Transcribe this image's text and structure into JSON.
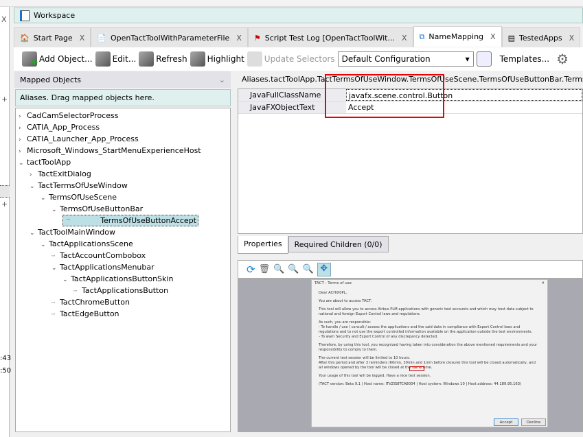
{
  "left_edge": {
    "close": "X",
    "plus": "+",
    "times": [
      ":43",
      ":50"
    ]
  },
  "workspace": {
    "title": "Workspace"
  },
  "tabs": [
    {
      "label": "Start Page",
      "close": "X"
    },
    {
      "label": "OpenTactToolWithParameterFile",
      "close": "X"
    },
    {
      "label": "Script Test Log [OpenTactToolWit...",
      "close": "X"
    },
    {
      "label": "NameMapping",
      "close": "X"
    },
    {
      "label": "TestedApps",
      "close": "X"
    }
  ],
  "toolbar": {
    "add": "Add Object...",
    "edit": "Edit...",
    "refresh": "Refresh",
    "highlight": "Highlight",
    "update": "Update Selectors",
    "config": "Default Configuration",
    "templates": "Templates..."
  },
  "mapped": {
    "title": "Mapped Objects",
    "aliases": "Aliases. Drag mapped objects here."
  },
  "tree": [
    {
      "label": "CadCamSelectorProcess",
      "toggle": ">"
    },
    {
      "label": "CATIA_App_Process",
      "toggle": ">"
    },
    {
      "label": "CATIA_Launcher_App_Process",
      "toggle": ">"
    },
    {
      "label": "Microsoft_Windows_StartMenuExperienceHost",
      "toggle": ">"
    },
    {
      "label": "tactToolApp",
      "toggle": "v"
    },
    {
      "label": "TactExitDialog",
      "toggle": ">"
    },
    {
      "label": "TactTermsOfUseWindow",
      "toggle": "v"
    },
    {
      "label": "TermsOfUseScene",
      "toggle": "v"
    },
    {
      "label": "TermsOfUseButtonBar",
      "toggle": "v"
    },
    {
      "label": "TermsOfUseButtonAccept",
      "toggle": ""
    },
    {
      "label": "TactToolMainWindow",
      "toggle": "v"
    },
    {
      "label": "TactApplicationsScene",
      "toggle": "v"
    },
    {
      "label": "TactAccountCombobox",
      "toggle": ""
    },
    {
      "label": "TactApplicationsMenubar",
      "toggle": "v"
    },
    {
      "label": "TactApplicationsButtonSkin",
      "toggle": "v"
    },
    {
      "label": "TactApplicationsButton",
      "toggle": ""
    },
    {
      "label": "TactChromeButton",
      "toggle": ""
    },
    {
      "label": "TactEdgeButton",
      "toggle": ""
    }
  ],
  "path": "Aliases.tactToolApp.TactTermsOfUseWindow.TermsOfUseScene.TermsOfUseButtonBar.TermsOfUseButtonAccept",
  "properties": [
    {
      "key": "JavaFullClassName",
      "value": "javafx.scene.control.Button"
    },
    {
      "key": "JavaFXObjectText",
      "value": "Accept"
    }
  ],
  "ptabs": {
    "properties": "Properties",
    "children": "Required Children (0/0)"
  },
  "dialog": {
    "title": "TACT - Terms of use",
    "close": "✕",
    "lines": [
      "Dear ACHIX0PL,",
      "You are about to access TACT.",
      "This tool will allow you to access Airbus PLM applications with generic test accounts and which may host data subject to national and foreign Export Control laws and regulations.",
      "As such, you are responsible:\n- To handle / use / consult / access the applications and the said data in compliance with Export Control laws and regulations and to not use the export controlled information available on the application outside the test environments.\n- To warn Security and Export Control of any discrepancy detected.",
      "Therefore, by using this tool, you recognized having taken into consideration the above mentioned requirements and your responsibility to comply to them.",
      "The current test session will be limited to 10 hours.\nAfter this period and after 3 reminders (60min, 30min and 1min before closure) this tool will be closed automatically, and all windows opened by the tool will be closed at the same time.",
      "Your usage of this tool will be logged. Have a nice test session.",
      "(TACT version: Beta 9.1 | Host name: ITVZIS8TCA8004 | Host system: Windows 10 | Host address: 44.189.95.163)"
    ],
    "accept": "Accept",
    "decline": "Decline"
  }
}
